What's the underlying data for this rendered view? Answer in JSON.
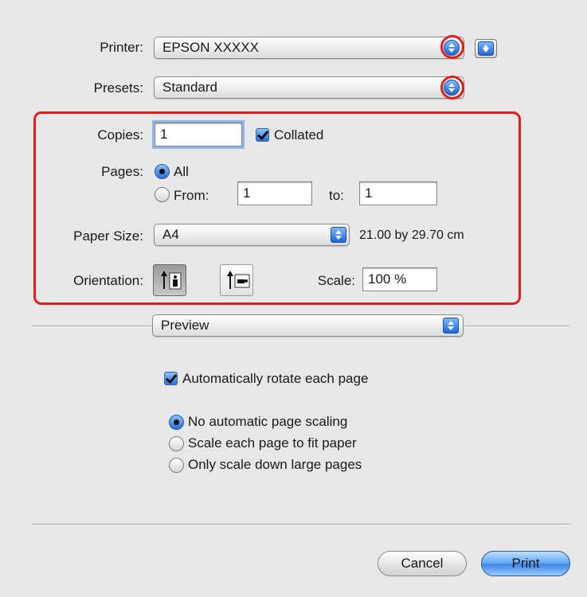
{
  "printer": {
    "label": "Printer:",
    "value": "EPSON XXXXX"
  },
  "presets": {
    "label": "Presets:",
    "value": "Standard"
  },
  "copies": {
    "label": "Copies:",
    "value": "1",
    "collated_label": "Collated"
  },
  "pages": {
    "label": "Pages:",
    "all_label": "All",
    "from_label": "From:",
    "from_value": "1",
    "to_label": "to:",
    "to_value": "1"
  },
  "paper": {
    "label": "Paper Size:",
    "value": "A4",
    "dimensions": "21.00 by 29.70 cm"
  },
  "orientation": {
    "label": "Orientation:"
  },
  "scale": {
    "label": "Scale:",
    "value": "100 %"
  },
  "section": {
    "value": "Preview"
  },
  "preview": {
    "auto_rotate_label": "Automatically rotate each page",
    "scaling_options": [
      "No automatic page scaling",
      "Scale each page to fit paper",
      "Only scale down large pages"
    ]
  },
  "buttons": {
    "cancel": "Cancel",
    "print": "Print"
  },
  "colors": {
    "highlight": "#e0201b",
    "accent": "#2a6fd6"
  }
}
